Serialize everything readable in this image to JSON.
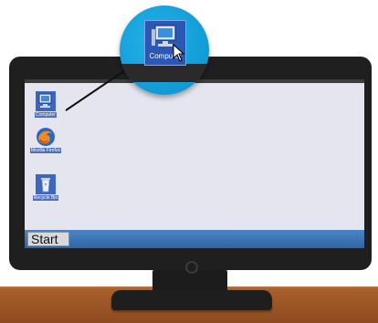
{
  "callout": {
    "icon_name": "computer-icon",
    "label": "Computer",
    "cursor_icon": "mouse-pointer-icon"
  },
  "desktop": {
    "icons": [
      {
        "name": "computer-icon",
        "label": "Computer"
      },
      {
        "name": "firefox-icon",
        "label": "Mozilla Firefox"
      },
      {
        "name": "recycle-bin-icon",
        "label": "Recycle Bin"
      }
    ]
  },
  "taskbar": {
    "start_label": "Start"
  },
  "colors": {
    "callout_blue": "#129bd6",
    "taskbar_blue": "#2f65a6",
    "screen": "#e5e5ef",
    "bezel": "#1f1f1f",
    "desk": "#8e4a1f"
  }
}
